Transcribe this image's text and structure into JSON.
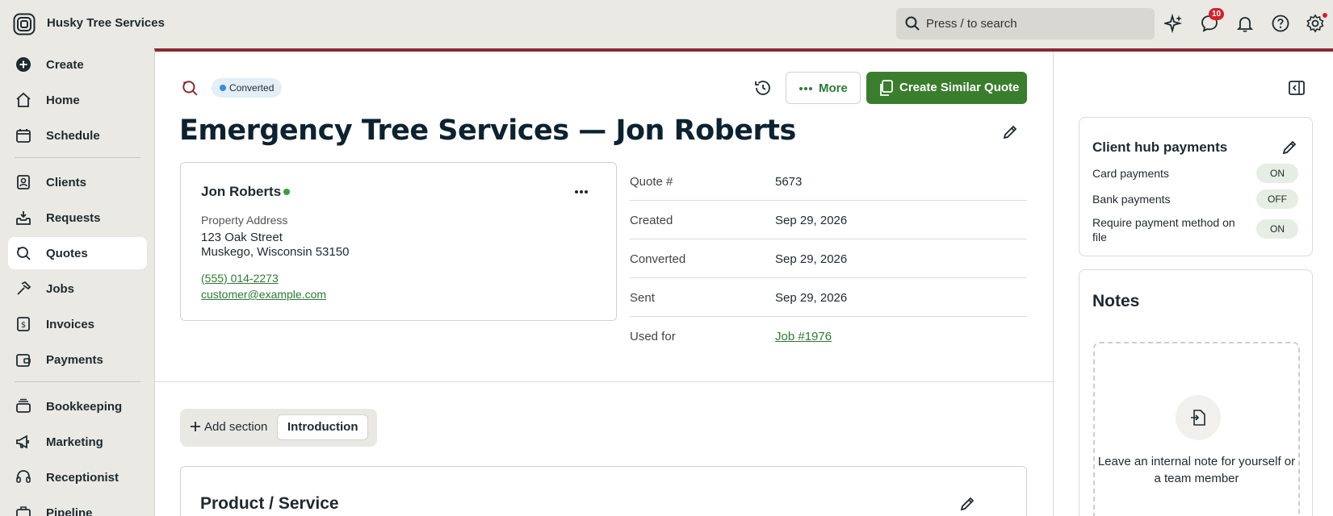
{
  "topbar": {
    "company": "Husky Tree Services",
    "search_placeholder": "Press / to search",
    "messages_badge": "10"
  },
  "sidebar": {
    "items": [
      {
        "label": "Create",
        "icon": "plus-circle-icon"
      },
      {
        "label": "Home",
        "icon": "home-icon"
      },
      {
        "label": "Schedule",
        "icon": "calendar-icon"
      },
      {
        "label": "Clients",
        "icon": "clients-icon"
      },
      {
        "label": "Requests",
        "icon": "inbox-icon"
      },
      {
        "label": "Quotes",
        "icon": "quote-icon",
        "active": true
      },
      {
        "label": "Jobs",
        "icon": "hammer-icon"
      },
      {
        "label": "Invoices",
        "icon": "invoice-icon"
      },
      {
        "label": "Payments",
        "icon": "wallet-icon"
      },
      {
        "label": "Bookkeeping",
        "icon": "bookkeeping-icon"
      },
      {
        "label": "Marketing",
        "icon": "megaphone-icon"
      },
      {
        "label": "Receptionist",
        "icon": "headset-icon"
      },
      {
        "label": "Pipeline",
        "icon": "briefcase-icon"
      }
    ]
  },
  "quote": {
    "status": "Converted",
    "more_label": "More",
    "create_similar_label": "Create Similar Quote",
    "title": "Emergency Tree Services — Jon Roberts",
    "client": {
      "name": "Jon Roberts",
      "property_label": "Property Address",
      "address_line1": "123 Oak Street",
      "address_line2": "Muskego, Wisconsin 53150",
      "phone": "(555) 014-2273",
      "email": "customer@example.com"
    },
    "details": [
      {
        "key": "Quote #",
        "value": "5673"
      },
      {
        "key": "Created",
        "value": "Sep 29, 2026"
      },
      {
        "key": "Converted",
        "value": "Sep 29, 2026"
      },
      {
        "key": "Sent",
        "value": "Sep 29, 2026"
      },
      {
        "key": "Used for",
        "value": "Job #1976",
        "link": true
      }
    ],
    "add_section_label": "Add section",
    "intro_tab": "Introduction",
    "product_service_title": "Product / Service"
  },
  "right_panel": {
    "hub_title": "Client hub payments",
    "hub_rows": [
      {
        "label": "Card payments",
        "state": "ON"
      },
      {
        "label": "Bank payments",
        "state": "OFF"
      },
      {
        "label": "Require payment method on file",
        "state": "ON"
      }
    ],
    "notes_title": "Notes",
    "notes_empty": "Leave an internal note for yourself or a team member"
  },
  "colors": {
    "accent_green": "#3a7d2d",
    "link_green": "#2e7a35",
    "top_border": "#8a2a33",
    "badge_red": "#d4222a",
    "status_blue": "#3b8bd4"
  }
}
